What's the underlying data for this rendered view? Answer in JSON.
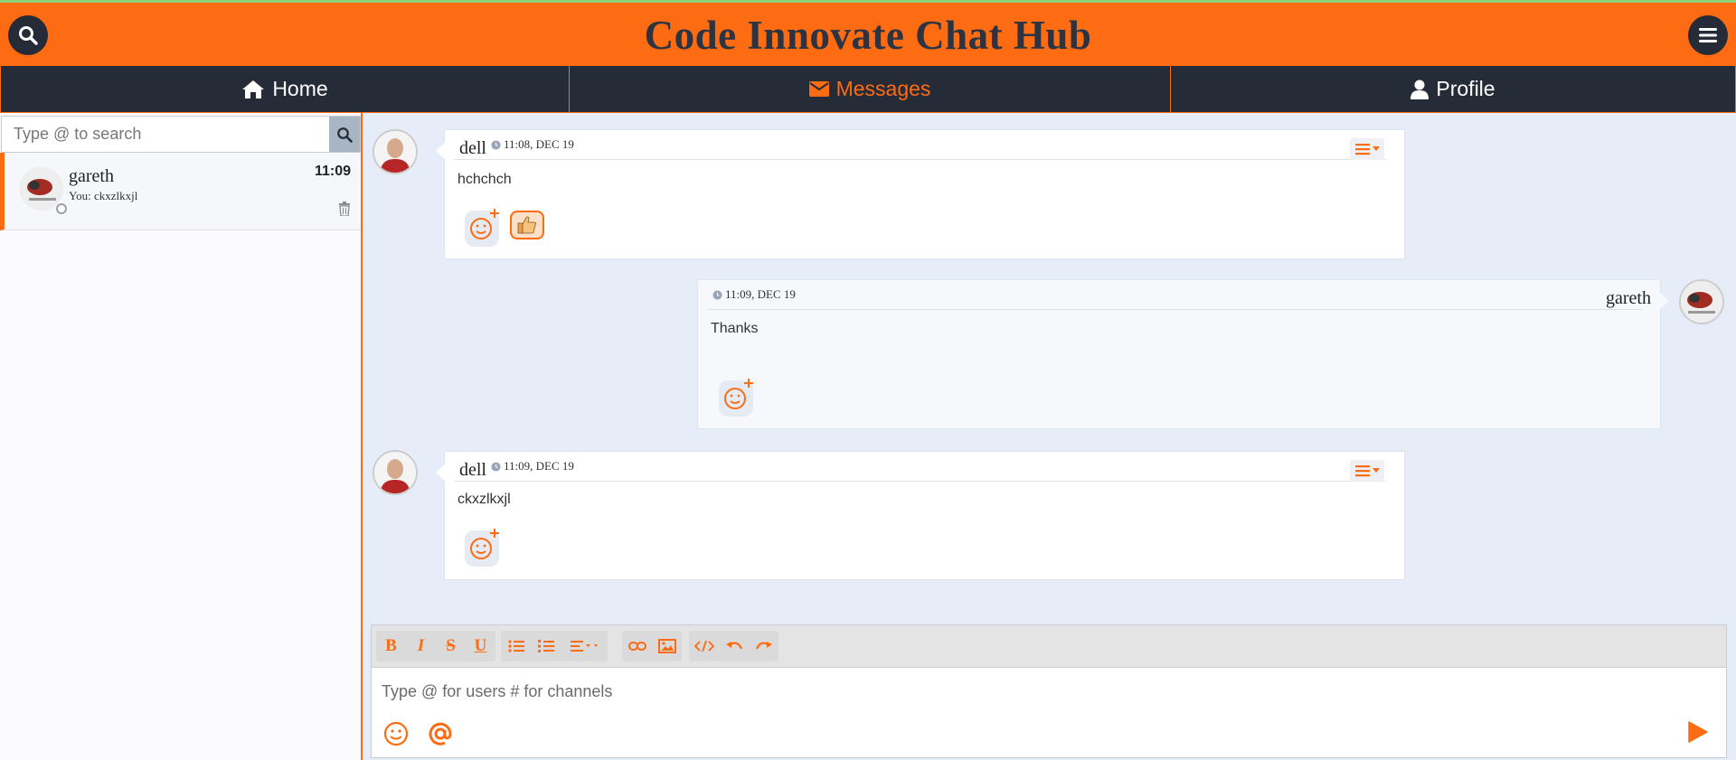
{
  "header": {
    "title": "Code Innovate Chat Hub",
    "search_icon": "search-icon",
    "menu_icon": "hamburger-menu-icon"
  },
  "nav": {
    "tabs": [
      {
        "label": "Home",
        "icon": "home-icon",
        "active": false
      },
      {
        "label": "Messages",
        "icon": "envelope-icon",
        "active": true
      },
      {
        "label": "Profile",
        "icon": "user-icon",
        "active": false
      }
    ]
  },
  "sidebar": {
    "search_placeholder": "Type @ to search",
    "conversations": [
      {
        "name": "gareth",
        "preview": "You: ckxzlkxjl",
        "time": "11:09"
      }
    ]
  },
  "messages": [
    {
      "sender": "dell",
      "timestamp": "11:08, DEC 19",
      "text": "hchchch",
      "own": false,
      "reactions": [
        {
          "icon": "thumbs-up-icon"
        }
      ]
    },
    {
      "sender": "gareth",
      "timestamp": "11:09, DEC 19",
      "text": "Thanks",
      "own": true,
      "reactions": []
    },
    {
      "sender": "dell",
      "timestamp": "11:09, DEC 19",
      "text": "ckxzlkxjl",
      "own": false,
      "reactions": []
    }
  ],
  "editor": {
    "placeholder": "Type @ for users # for channels",
    "toolbar": {
      "bold": "B",
      "italic": "I",
      "strike": "S",
      "underline": "U"
    }
  },
  "colors": {
    "accent": "#fd6b12",
    "nav_bg": "#252b37",
    "chat_bg": "#e7edf8"
  }
}
